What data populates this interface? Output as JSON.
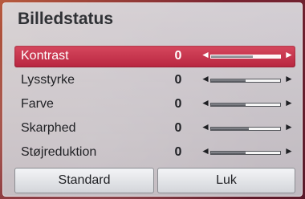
{
  "dialog": {
    "title": "Billedstatus"
  },
  "settings": [
    {
      "label": "Kontrast",
      "value": "0",
      "level": 0.6,
      "selected": true
    },
    {
      "label": "Lysstyrke",
      "value": "0",
      "level": 0.5,
      "selected": false
    },
    {
      "label": "Farve",
      "value": "0",
      "level": 0.5,
      "selected": false
    },
    {
      "label": "Skarphed",
      "value": "0",
      "level": 0.55,
      "selected": false
    },
    {
      "label": "Støjreduktion",
      "value": "0",
      "level": 0.5,
      "selected": false
    }
  ],
  "icons": {
    "left": "◄",
    "right": "►"
  },
  "buttons": {
    "standard_label": "Standard",
    "close_label": "Luk"
  },
  "colors": {
    "selected_row": "#c8304a",
    "panel": "#d5d7dc"
  }
}
